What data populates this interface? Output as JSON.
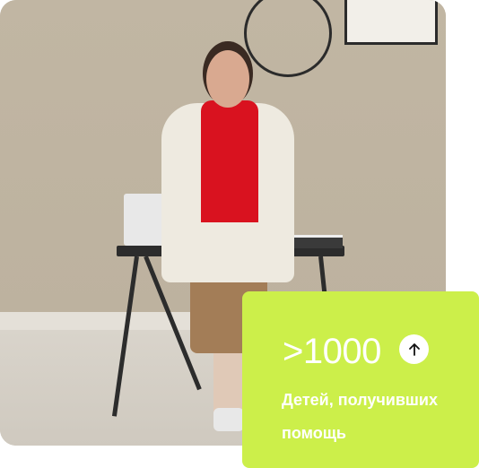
{
  "stat": {
    "value": ">1000",
    "label": "Детей, получивших помощь",
    "icon": "arrow-up-icon"
  },
  "colors": {
    "card_bg": "#ccef4a",
    "text": "#ffffff"
  }
}
